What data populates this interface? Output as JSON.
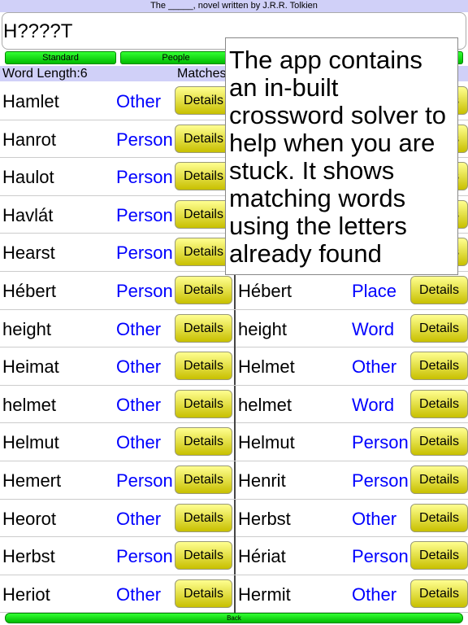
{
  "clue": "The _____, novel written by J.R.R. Tolkien",
  "pattern": "H????T",
  "tabs": [
    "Standard",
    "People",
    ""
  ],
  "word_length": "Word Length:6",
  "matches": "Matches",
  "details_label": "Details",
  "back_label": "Back",
  "popup": "The app contains an in-built crossword solver to help when you are stuck. It shows matching words using the letters already found",
  "left": [
    [
      "Hamlet",
      "Other"
    ],
    [
      "Hanrot",
      "Person"
    ],
    [
      "Haulot",
      "Person"
    ],
    [
      "Havlát",
      "Person"
    ],
    [
      "Hearst",
      "Person"
    ],
    [
      "Hébert",
      "Person"
    ],
    [
      "height",
      "Other"
    ],
    [
      "Heimat",
      "Other"
    ],
    [
      "helmet",
      "Other"
    ],
    [
      "Helmut",
      "Other"
    ],
    [
      "Hemert",
      "Person"
    ],
    [
      "Heorot",
      "Other"
    ],
    [
      "Herbst",
      "Person"
    ],
    [
      "Heriot",
      "Other"
    ]
  ],
  "right": [
    [
      "",
      ""
    ],
    [
      "",
      ""
    ],
    [
      "",
      ""
    ],
    [
      "",
      ""
    ],
    [
      "",
      ""
    ],
    [
      "Hébert",
      "Place"
    ],
    [
      "height",
      "Word"
    ],
    [
      "Helmet",
      "Other"
    ],
    [
      "helmet",
      "Word"
    ],
    [
      "Helmut",
      "Person"
    ],
    [
      "Henrit",
      "Person"
    ],
    [
      "Herbst",
      "Other"
    ],
    [
      "Hériat",
      "Person"
    ],
    [
      "Hermit",
      "Other"
    ]
  ]
}
